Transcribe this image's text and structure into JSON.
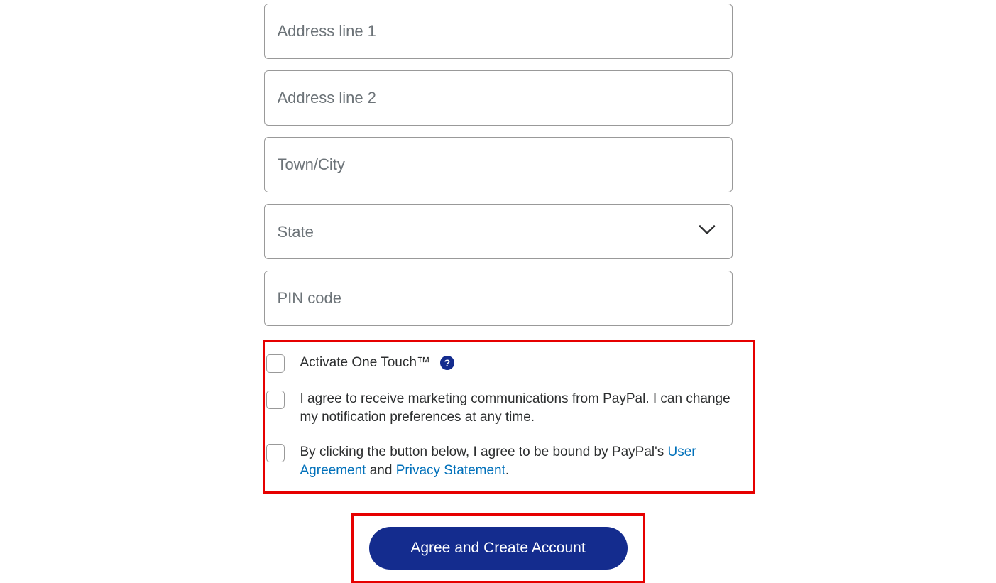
{
  "form": {
    "address_line_1_placeholder": "Address line 1",
    "address_line_2_placeholder": "Address line 2",
    "town_city_placeholder": "Town/City",
    "state_placeholder": "State",
    "pin_code_placeholder": "PIN code"
  },
  "checkboxes": {
    "one_touch_label": "Activate One Touch™",
    "marketing_label": "I agree to receive marketing communications from PayPal. I can change my notification preferences at any time.",
    "terms_prefix": "By clicking the button below, I agree to be bound by PayPal's ",
    "user_agreement_link": "User Agreement",
    "terms_middle": " and ",
    "privacy_statement_link": "Privacy Statement",
    "terms_suffix": "."
  },
  "button": {
    "submit_label": "Agree and Create Account"
  },
  "help_icon": "?"
}
